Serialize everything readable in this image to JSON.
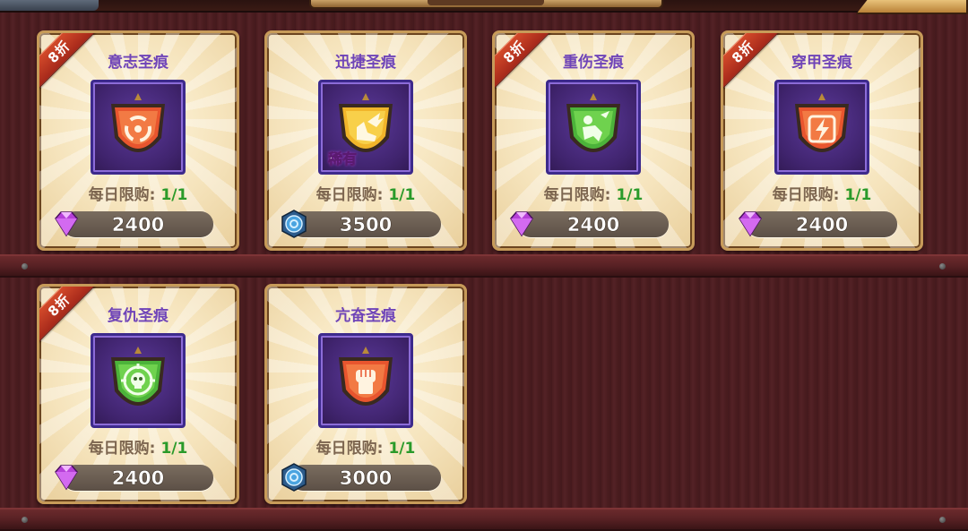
{
  "colors": {
    "title": "#6f44b8",
    "limit_count": "#2a9a2a",
    "ribbon": "#c23a22"
  },
  "shop": {
    "items": [
      {
        "name": "意志圣痕",
        "discount": "8折",
        "limit_label": "每日限购:",
        "limit_count": "1/1",
        "price": "2400",
        "currency": "gem-icon",
        "shield_color": "#e8552e",
        "emblem": "swirl-icon"
      },
      {
        "name": "迅捷圣痕",
        "discount": "",
        "rarity": "稀有",
        "limit_label": "每日限购:",
        "limit_count": "1/1",
        "price": "3500",
        "currency": "coin-icon",
        "shield_color": "#f1b52a",
        "emblem": "winged-boot-icon"
      },
      {
        "name": "重伤圣痕",
        "discount": "8折",
        "limit_label": "每日限购:",
        "limit_count": "1/1",
        "price": "2400",
        "currency": "gem-icon",
        "shield_color": "#4cb33a",
        "emblem": "broken-figure-icon"
      },
      {
        "name": "穿甲圣痕",
        "discount": "8折",
        "limit_label": "每日限购:",
        "limit_count": "1/1",
        "price": "2400",
        "currency": "gem-icon",
        "shield_color": "#e8552e",
        "emblem": "lightning-icon"
      },
      {
        "name": "复仇圣痕",
        "discount": "8折",
        "limit_label": "每日限购:",
        "limit_count": "1/1",
        "price": "2400",
        "currency": "gem-icon",
        "shield_color": "#4cb33a",
        "emblem": "skull-target-icon"
      },
      {
        "name": "亢奋圣痕",
        "discount": "",
        "limit_label": "每日限购:",
        "limit_count": "1/1",
        "price": "3000",
        "currency": "coin-icon",
        "shield_color": "#e8552e",
        "emblem": "fist-icon"
      }
    ]
  }
}
